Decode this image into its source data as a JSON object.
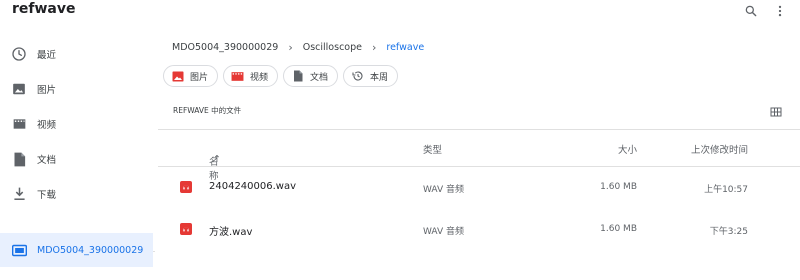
{
  "app": {
    "title": "refwave"
  },
  "toolbar": {
    "search_icon": "search-icon",
    "more_icon": "more-vert-icon"
  },
  "sidebar": {
    "items": [
      {
        "label": "最近",
        "icon": "clock-icon"
      },
      {
        "label": "图片",
        "icon": "image-icon"
      },
      {
        "label": "视频",
        "icon": "video-icon"
      },
      {
        "label": "文档",
        "icon": "document-icon"
      },
      {
        "label": "下载",
        "icon": "download-icon"
      }
    ],
    "device": {
      "label": "MDO5004_390000029",
      "icon": "usb-storage-icon",
      "selected": true
    }
  },
  "breadcrumb": [
    "MDO5004_390000029",
    "Oscilloscope",
    "refwave"
  ],
  "chips": [
    {
      "label": "图片",
      "icon": "image-icon",
      "color": "#e53935"
    },
    {
      "label": "视频",
      "icon": "video-icon",
      "color": "#e53935"
    },
    {
      "label": "文档",
      "icon": "document-icon",
      "color": "#5f6368"
    },
    {
      "label": "本周",
      "icon": "history-icon",
      "color": "#5f6368"
    }
  ],
  "section": {
    "label": "REFWAVE 中的文件"
  },
  "table": {
    "headers": {
      "name": "名称",
      "type": "类型",
      "size": "大小",
      "modified": "上次修改时间"
    },
    "sort_indicator": "↑",
    "rows": [
      {
        "name": "2404240006.wav",
        "type": "WAV 音频",
        "size": "1.60 MB",
        "modified": "上午10:57"
      },
      {
        "name": "方波.wav",
        "type": "WAV 音频",
        "size": "1.60 MB",
        "modified": "下午3:25"
      }
    ]
  },
  "colors": {
    "accent": "#1a73e8",
    "selected_bg": "#e8f0fe",
    "audio_icon": "#e53935"
  }
}
